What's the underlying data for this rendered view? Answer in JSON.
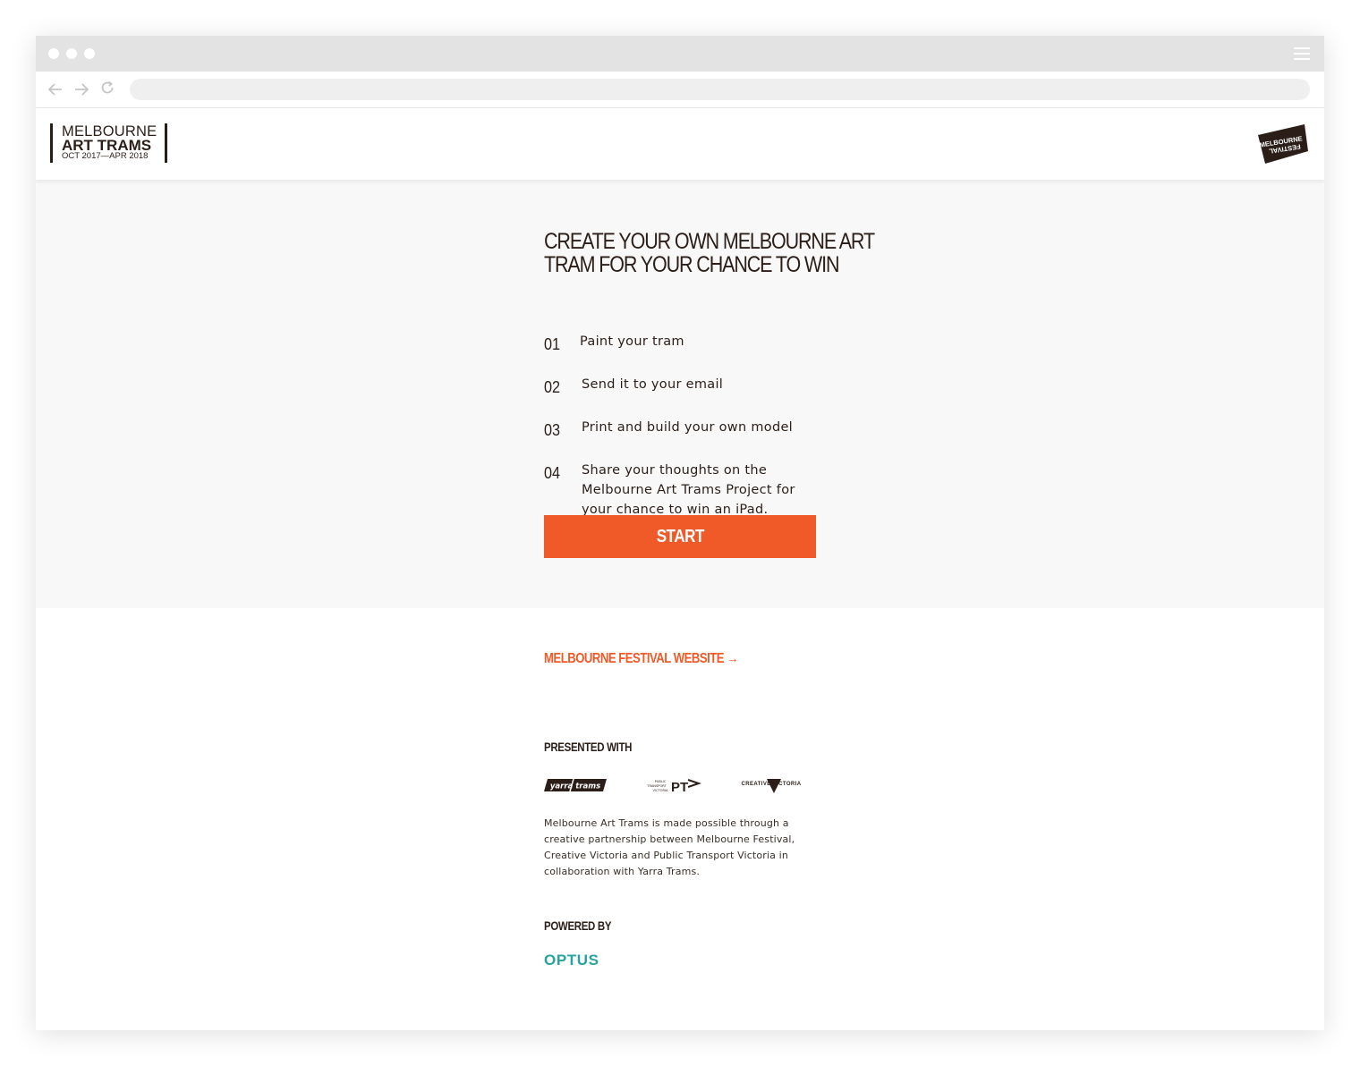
{
  "brand": {
    "line1": "MELBOURNE",
    "line2": "ART TRAMS",
    "line3": "OCT 2017—APR 2018"
  },
  "festival_logo": {
    "text_top": "MELBOURNE",
    "text_bottom": "FESTIVAL"
  },
  "hero": {
    "title_line1": "CREATE YOUR OWN MELBOURNE ART",
    "title_line2": "TRAM FOR YOUR CHANCE TO WIN",
    "steps": [
      {
        "num": "01",
        "text": "Paint your tram"
      },
      {
        "num": "02",
        "text": "Send it to your email"
      },
      {
        "num": "03",
        "text": "Print and build your own model"
      },
      {
        "num": "04",
        "text": "Share your thoughts on the Melbourne Art Trams Project for your chance to win an iPad."
      }
    ],
    "start_label": "START"
  },
  "footer": {
    "festival_link": "MELBOURNE FESTIVAL WEBSITE →",
    "presented_with": "PRESENTED WITH",
    "partners": {
      "yarra": "yarra trams",
      "ptv_small": [
        "PUBLIC",
        "TRANSPORT",
        "VICTORIA"
      ],
      "ptv_big": "PT",
      "creative_victoria": "CREATIVE VICTORIA"
    },
    "description": "Melbourne Art Trams is made possible through a creative partnership between Melbourne Festival, Creative Victoria and Public Transport Victoria in collaboration with Yarra Trams.",
    "powered_by": "POWERED BY",
    "optus": "OPTUS"
  },
  "colors": {
    "accent": "#f05a28",
    "text_dark": "#2b1e18",
    "optus_teal": "#27a3a0",
    "hero_bg": "#f8f8f8"
  },
  "icons": {
    "back": "arrow-left-icon",
    "forward": "arrow-right-icon",
    "reload": "reload-icon",
    "menu": "hamburger-menu-icon"
  }
}
